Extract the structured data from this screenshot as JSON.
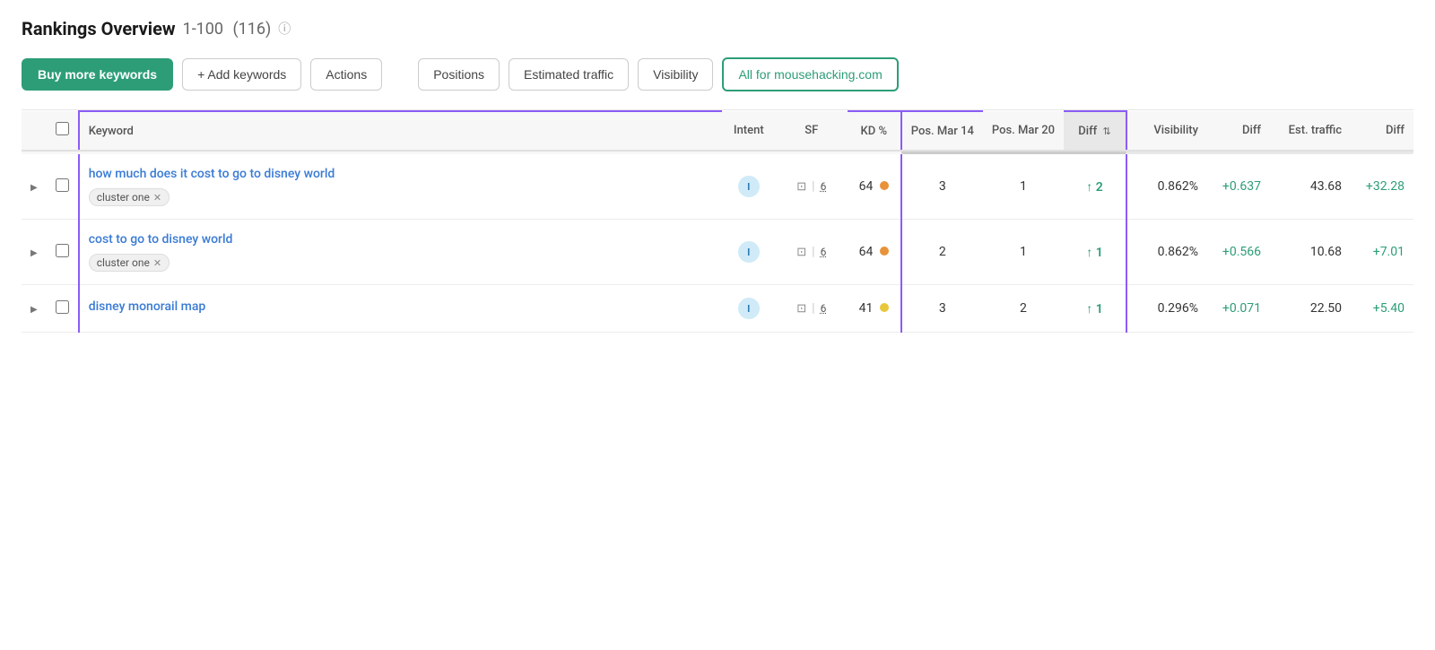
{
  "header": {
    "title": "Rankings Overview",
    "range": "1-100",
    "total": "(116)",
    "info_label": "i"
  },
  "toolbar": {
    "buy_keywords": "Buy more keywords",
    "add_keywords": "+ Add keywords",
    "actions": "Actions",
    "tabs": [
      {
        "id": "positions",
        "label": "Positions"
      },
      {
        "id": "estimated_traffic",
        "label": "Estimated traffic"
      },
      {
        "id": "visibility",
        "label": "Visibility"
      },
      {
        "id": "all_for",
        "label": "All for mousehacking.com",
        "active": true
      }
    ]
  },
  "table": {
    "columns": [
      {
        "id": "expand",
        "label": ""
      },
      {
        "id": "checkbox",
        "label": ""
      },
      {
        "id": "keyword",
        "label": "Keyword"
      },
      {
        "id": "intent",
        "label": "Intent"
      },
      {
        "id": "sf",
        "label": "SF"
      },
      {
        "id": "kd",
        "label": "KD %"
      },
      {
        "id": "pos_mar14",
        "label": "Pos. Mar 14"
      },
      {
        "id": "pos_mar20",
        "label": "Pos. Mar 20"
      },
      {
        "id": "diff1",
        "label": "Diff",
        "sortable": true
      },
      {
        "id": "visibility",
        "label": "Visibility"
      },
      {
        "id": "diff2",
        "label": "Diff"
      },
      {
        "id": "est_traffic",
        "label": "Est. traffic"
      },
      {
        "id": "diff3",
        "label": "Diff"
      }
    ],
    "rows": [
      {
        "id": "row1",
        "keyword": "how much does it cost to go to disney world",
        "cluster": "cluster one",
        "intent": "I",
        "sf": "6",
        "kd": "64",
        "kd_color": "orange",
        "pos_mar14": "3",
        "pos_mar20": "1",
        "diff": "↑ 2",
        "diff_direction": "up",
        "visibility": "0.862%",
        "vis_diff": "+0.637",
        "est_traffic": "43.68",
        "traffic_diff": "+32.28"
      },
      {
        "id": "row2",
        "keyword": "cost to go to disney world",
        "cluster": "cluster one",
        "intent": "I",
        "sf": "6",
        "kd": "64",
        "kd_color": "orange",
        "pos_mar14": "2",
        "pos_mar20": "1",
        "diff": "↑ 1",
        "diff_direction": "up",
        "visibility": "0.862%",
        "vis_diff": "+0.566",
        "est_traffic": "10.68",
        "traffic_diff": "+7.01"
      },
      {
        "id": "row3",
        "keyword": "disney monorail map",
        "cluster": null,
        "intent": "I",
        "sf": "6",
        "kd": "41",
        "kd_color": "yellow",
        "pos_mar14": "3",
        "pos_mar20": "2",
        "diff": "↑ 1",
        "diff_direction": "up",
        "visibility": "0.296%",
        "vis_diff": "+0.071",
        "est_traffic": "22.50",
        "traffic_diff": "+5.40"
      }
    ]
  }
}
